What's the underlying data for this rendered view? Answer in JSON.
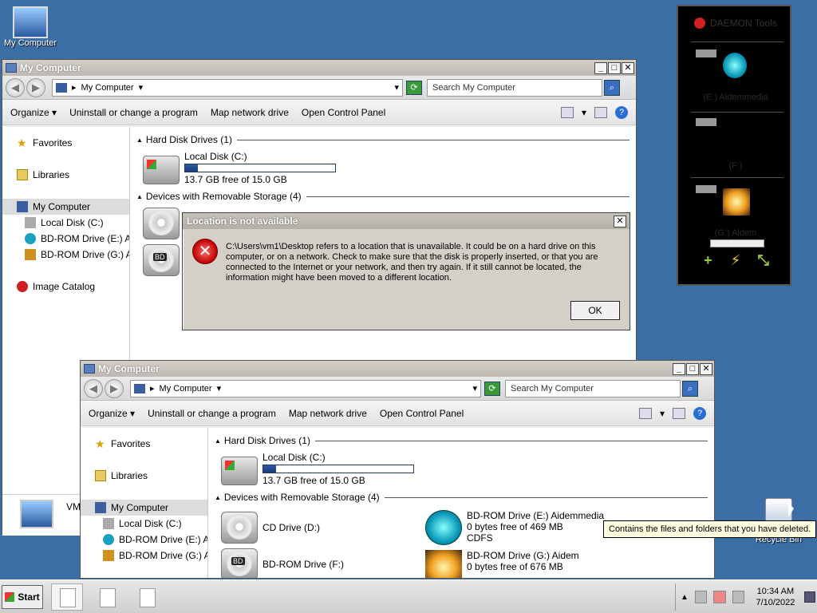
{
  "desktop": {
    "my_computer_label": "My Computer",
    "recycle_bin_label": "Recycle Bin",
    "behind_window_label": "VM"
  },
  "window1": {
    "title": "My Computer",
    "address": "My Computer",
    "search_placeholder": "Search My Computer",
    "toolbar": {
      "organize": "Organize",
      "uninstall": "Uninstall or change a program",
      "map_drive": "Map network drive",
      "control_panel": "Open Control Panel"
    },
    "nav": {
      "favorites": "Favorites",
      "libraries": "Libraries",
      "my_computer": "My Computer",
      "local_disk": "Local Disk (C:)",
      "bd_e": "BD-ROM Drive (E:) Aid",
      "bd_g": "BD-ROM Drive (G:) Aic",
      "image_catalog": "Image Catalog"
    },
    "groups": {
      "hdd": "Hard Disk Drives (1)",
      "removable": "Devices with Removable Storage (4)"
    },
    "local_disk": {
      "name": "Local Disk (C:)",
      "free": "13.7 GB free of 15.0 GB",
      "used_fraction": 0.087
    }
  },
  "window2": {
    "title": "My Computer",
    "address": "My Computer",
    "search_placeholder": "Search My Computer",
    "toolbar": {
      "organize": "Organize",
      "uninstall": "Uninstall or change a program",
      "map_drive": "Map network drive",
      "control_panel": "Open Control Panel"
    },
    "nav": {
      "favorites": "Favorites",
      "libraries": "Libraries",
      "my_computer": "My Computer",
      "local_disk": "Local Disk (C:)",
      "bd_e": "BD-ROM Drive (E:) Aid",
      "bd_g": "BD-ROM Drive (G:) Aic"
    },
    "groups": {
      "hdd": "Hard Disk Drives (1)",
      "removable": "Devices with Removable Storage (4)"
    },
    "local_disk": {
      "name": "Local Disk (C:)",
      "free": "13.7 GB free of 15.0 GB",
      "used_fraction": 0.087
    },
    "devices": {
      "cd_d": "CD Drive (D:)",
      "bd_f": "BD-ROM Drive (F:)",
      "bd_e_name": "BD-ROM Drive (E:) Aidemmedia",
      "bd_e_free": "0 bytes free of 469 MB",
      "bd_e_fs": "CDFS",
      "bd_g_name": "BD-ROM Drive (G:) Aidem",
      "bd_g_free": "0 bytes free of 676 MB"
    }
  },
  "dialog": {
    "title": "Location is not available",
    "message": "C:\\Users\\vm1\\Desktop refers to a location that is unavailable. It could be on a hard drive on this computer, or on a network. Check to make sure that the disk is properly inserted, or that you are connected to the Internet or your network, and then try again. If it still cannot be located, the information might have been moved to a different location.",
    "ok": "OK"
  },
  "gadget": {
    "title": "DAEMON Tools",
    "slot_e": "(E:) Aidemmedia",
    "slot_f": "(F:)",
    "slot_g": "(G:) Aidem"
  },
  "tooltip": "Contains the files and folders that you have deleted.",
  "taskbar": {
    "start": "Start",
    "time": "10:34 AM",
    "date": "7/10/2022"
  }
}
